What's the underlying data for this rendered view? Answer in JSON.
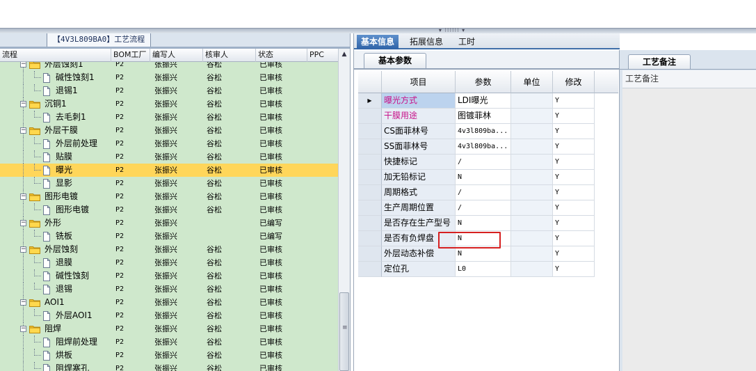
{
  "left_panel": {
    "flow_tab": "【4V3L809BA0】工艺流程",
    "columns": [
      "流程",
      "BOM工厂",
      "编写人",
      "核审人",
      "状态",
      "PPC"
    ],
    "rows": [
      {
        "name": "外层蚀刻1",
        "level": 0,
        "type": "folder",
        "bom": "P2",
        "writer": "张振兴",
        "reviewer": "谷松",
        "status": "已审核"
      },
      {
        "name": "碱性蚀刻1",
        "level": 1,
        "type": "file",
        "bom": "P2",
        "writer": "张振兴",
        "reviewer": "谷松",
        "status": "已审核"
      },
      {
        "name": "退锡1",
        "level": 1,
        "type": "file",
        "bom": "P2",
        "writer": "张振兴",
        "reviewer": "谷松",
        "status": "已审核"
      },
      {
        "name": "沉铜1",
        "level": 0,
        "type": "folder",
        "bom": "P2",
        "writer": "张振兴",
        "reviewer": "谷松",
        "status": "已审核"
      },
      {
        "name": "去毛刺1",
        "level": 1,
        "type": "file",
        "bom": "P2",
        "writer": "张振兴",
        "reviewer": "谷松",
        "status": "已审核"
      },
      {
        "name": "外层干膜",
        "level": 0,
        "type": "folder",
        "bom": "P2",
        "writer": "张振兴",
        "reviewer": "谷松",
        "status": "已审核"
      },
      {
        "name": "外层前处理",
        "level": 1,
        "type": "file",
        "bom": "P2",
        "writer": "张振兴",
        "reviewer": "谷松",
        "status": "已审核"
      },
      {
        "name": "贴膜",
        "level": 1,
        "type": "file",
        "bom": "P2",
        "writer": "张振兴",
        "reviewer": "谷松",
        "status": "已审核"
      },
      {
        "name": "曝光",
        "level": 1,
        "type": "file",
        "bom": "P2",
        "writer": "张振兴",
        "reviewer": "谷松",
        "status": "已审核",
        "selected": true
      },
      {
        "name": "显影",
        "level": 1,
        "type": "file",
        "bom": "P2",
        "writer": "张振兴",
        "reviewer": "谷松",
        "status": "已审核"
      },
      {
        "name": "图形电镀",
        "level": 0,
        "type": "folder",
        "bom": "P2",
        "writer": "张振兴",
        "reviewer": "谷松",
        "status": "已审核"
      },
      {
        "name": "图形电镀",
        "level": 1,
        "type": "file",
        "bom": "P2",
        "writer": "张振兴",
        "reviewer": "谷松",
        "status": "已审核"
      },
      {
        "name": "外形",
        "level": 0,
        "type": "folder",
        "bom": "P2",
        "writer": "张振兴",
        "reviewer": "",
        "status": "已编写"
      },
      {
        "name": "铣板",
        "level": 1,
        "type": "file",
        "bom": "P2",
        "writer": "张振兴",
        "reviewer": "",
        "status": "已编写"
      },
      {
        "name": "外层蚀刻",
        "level": 0,
        "type": "folder",
        "bom": "P2",
        "writer": "张振兴",
        "reviewer": "谷松",
        "status": "已审核"
      },
      {
        "name": "退膜",
        "level": 1,
        "type": "file",
        "bom": "P2",
        "writer": "张振兴",
        "reviewer": "谷松",
        "status": "已审核"
      },
      {
        "name": "碱性蚀刻",
        "level": 1,
        "type": "file",
        "bom": "P2",
        "writer": "张振兴",
        "reviewer": "谷松",
        "status": "已审核"
      },
      {
        "name": "退锡",
        "level": 1,
        "type": "file",
        "bom": "P2",
        "writer": "张振兴",
        "reviewer": "谷松",
        "status": "已审核"
      },
      {
        "name": "AOI1",
        "level": 0,
        "type": "folder",
        "bom": "P2",
        "writer": "张振兴",
        "reviewer": "谷松",
        "status": "已审核"
      },
      {
        "name": "外层AOI1",
        "level": 1,
        "type": "file",
        "bom": "P2",
        "writer": "张振兴",
        "reviewer": "谷松",
        "status": "已审核"
      },
      {
        "name": "阻焊",
        "level": 0,
        "type": "folder",
        "bom": "P2",
        "writer": "张振兴",
        "reviewer": "谷松",
        "status": "已审核"
      },
      {
        "name": "阻焊前处理",
        "level": 1,
        "type": "file",
        "bom": "P2",
        "writer": "张振兴",
        "reviewer": "谷松",
        "status": "已审核"
      },
      {
        "name": "烘板",
        "level": 1,
        "type": "file",
        "bom": "P2",
        "writer": "张振兴",
        "reviewer": "谷松",
        "status": "已审核"
      },
      {
        "name": "阻焊塞孔",
        "level": 1,
        "type": "file",
        "bom": "P2",
        "writer": "张振兴",
        "reviewer": "谷松",
        "status": "已审核"
      }
    ]
  },
  "middle_panel": {
    "tabs": [
      "基本信息",
      "拓展信息",
      "工时"
    ],
    "active_tab": 0,
    "sub_tab": "基本参数",
    "columns": [
      "项目",
      "参数",
      "单位",
      "修改"
    ],
    "rows": [
      {
        "item": "曝光方式",
        "value": "LDI曝光",
        "unit": "",
        "mod": "Y",
        "pink": true,
        "mono": false
      },
      {
        "item": "干膜用途",
        "value": "图镀菲林",
        "unit": "",
        "mod": "Y",
        "pink": true,
        "mono": false
      },
      {
        "item": "CS面菲林号",
        "value": "4v3l809ba...",
        "unit": "",
        "mod": "Y",
        "pink": false,
        "mono": true
      },
      {
        "item": "SS面菲林号",
        "value": "4v3l809ba...",
        "unit": "",
        "mod": "Y",
        "pink": false,
        "mono": true
      },
      {
        "item": "快捷标记",
        "value": "/",
        "unit": "",
        "mod": "Y",
        "pink": false,
        "mono": true
      },
      {
        "item": "加无铅标记",
        "value": "N",
        "unit": "",
        "mod": "Y",
        "pink": false,
        "mono": true
      },
      {
        "item": "周期格式",
        "value": "/",
        "unit": "",
        "mod": "Y",
        "pink": false,
        "mono": true
      },
      {
        "item": "生产周期位置",
        "value": "/",
        "unit": "",
        "mod": "Y",
        "pink": false,
        "mono": true
      },
      {
        "item": "是否存在生产型号",
        "value": "N",
        "unit": "",
        "mod": "Y",
        "pink": false,
        "mono": true
      },
      {
        "item": "是否有负焊盘",
        "value": "N",
        "unit": "",
        "mod": "Y",
        "pink": false,
        "mono": true
      },
      {
        "item": "外层动态补偿",
        "value": "N",
        "unit": "",
        "mod": "Y",
        "pink": false,
        "mono": true
      },
      {
        "item": "定位孔",
        "value": "L0",
        "unit": "",
        "mod": "Y",
        "pink": false,
        "mono": true
      }
    ]
  },
  "right_panel": {
    "tab": "工艺备注",
    "title": "工艺备注"
  },
  "colors": {
    "tree_bg": "#cfe8cc",
    "selected_row": "#ffd65a",
    "active_tab": "#2f63a7",
    "highlight_box": "#d62020",
    "pink_text": "#c7138a"
  }
}
